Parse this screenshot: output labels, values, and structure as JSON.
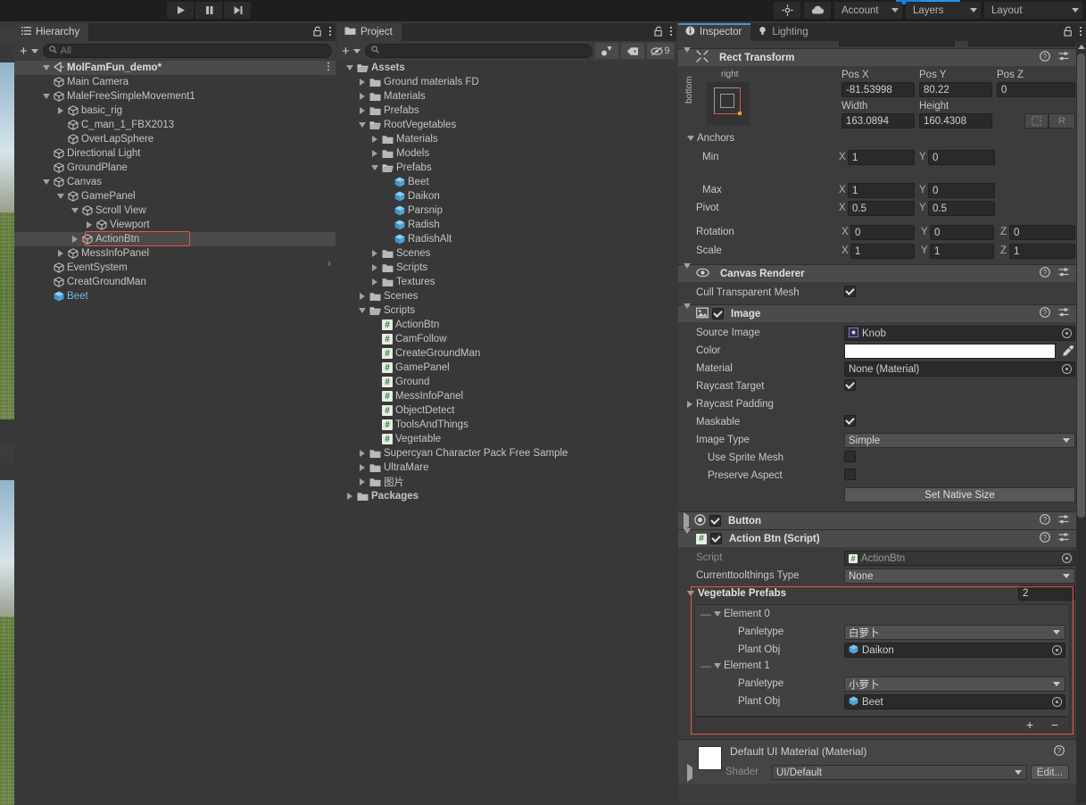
{
  "toolbar": {
    "play_icon": "play-icon",
    "pause_icon": "pause-icon",
    "step_icon": "step-icon",
    "settings_icon": "scene-lighting-icon",
    "cloud_icon": "cloud-icon",
    "account_label": "Account",
    "layers_label": "Layers",
    "layout_label": "Layout",
    "accent_blue": "#2196f3"
  },
  "hierarchy": {
    "tab_label": "Hierarchy",
    "tab_icon": "hierarchy-icon",
    "lock_icon": "lock-icon",
    "menu_icon": "kebab-menu-icon",
    "add_label": "+",
    "search_placeholder": "All",
    "search_value": "",
    "search_icon": "search-icon",
    "scene_name": "MolFamFun_demo*",
    "selected": "ActionBtn",
    "selection_outline_color": "#e8534a",
    "items": [
      {
        "label": "Main Camera",
        "depth": 2,
        "arrow": "none",
        "icon": "gameobject-icon",
        "style": "normal"
      },
      {
        "label": "MaleFreeSimpleMovement1",
        "depth": 2,
        "arrow": "down",
        "icon": "gameobject-icon",
        "style": "normal"
      },
      {
        "label": "basic_rig",
        "depth": 3,
        "arrow": "right",
        "icon": "gameobject-icon",
        "style": "normal"
      },
      {
        "label": "C_man_1_FBX2013",
        "depth": 3,
        "arrow": "none",
        "icon": "gameobject-icon",
        "style": "normal"
      },
      {
        "label": "OverLapSphere",
        "depth": 3,
        "arrow": "none",
        "icon": "gameobject-icon",
        "style": "normal"
      },
      {
        "label": "Directional Light",
        "depth": 2,
        "arrow": "none",
        "icon": "gameobject-icon",
        "style": "normal"
      },
      {
        "label": "GroundPlane",
        "depth": 2,
        "arrow": "none",
        "icon": "gameobject-icon",
        "style": "normal"
      },
      {
        "label": "Canvas",
        "depth": 2,
        "arrow": "down",
        "icon": "gameobject-icon",
        "style": "normal"
      },
      {
        "label": "GamePanel",
        "depth": 3,
        "arrow": "down",
        "icon": "gameobject-icon",
        "style": "normal"
      },
      {
        "label": "Scroll View",
        "depth": 4,
        "arrow": "down",
        "icon": "gameobject-icon",
        "style": "normal"
      },
      {
        "label": "Viewport",
        "depth": 5,
        "arrow": "right",
        "icon": "gameobject-icon",
        "style": "normal"
      },
      {
        "label": "ActionBtn",
        "depth": 4,
        "arrow": "right",
        "icon": "gameobject-icon",
        "style": "selected"
      },
      {
        "label": "MessInfoPanel",
        "depth": 3,
        "arrow": "right",
        "icon": "gameobject-icon",
        "style": "normal"
      },
      {
        "label": "EventSystem",
        "depth": 2,
        "arrow": "none",
        "icon": "gameobject-icon",
        "style": "normal"
      },
      {
        "label": "CreatGroundMan",
        "depth": 2,
        "arrow": "none",
        "icon": "gameobject-icon",
        "style": "normal"
      },
      {
        "label": "Beet",
        "depth": 2,
        "arrow": "none",
        "icon": "prefab-icon",
        "style": "prefab"
      }
    ]
  },
  "project": {
    "tab_label": "Project",
    "tab_icon": "folder-icon",
    "lock_icon": "lock-icon",
    "menu_icon": "kebab-menu-icon",
    "add_label": "+",
    "search_placeholder": "",
    "search_value": "",
    "search_icon": "search-icon",
    "filter_type_icon": "search-by-type-icon",
    "filter_label_icon": "search-by-label-icon",
    "hidden_icon": "hidden-objects-icon",
    "hidden_count": "9",
    "items": [
      {
        "label": "Assets",
        "depth": 0,
        "arrow": "down",
        "icon": "folder-open-icon",
        "bold": true
      },
      {
        "label": "Ground materials FD",
        "depth": 1,
        "arrow": "right",
        "icon": "folder-icon",
        "bold": false
      },
      {
        "label": "Materials",
        "depth": 1,
        "arrow": "right",
        "icon": "folder-icon",
        "bold": false
      },
      {
        "label": "Prefabs",
        "depth": 1,
        "arrow": "right",
        "icon": "folder-icon",
        "bold": false
      },
      {
        "label": "RootVegetables",
        "depth": 1,
        "arrow": "down",
        "icon": "folder-open-icon",
        "bold": false
      },
      {
        "label": "Materials",
        "depth": 2,
        "arrow": "right",
        "icon": "folder-icon",
        "bold": false
      },
      {
        "label": "Models",
        "depth": 2,
        "arrow": "right",
        "icon": "folder-icon",
        "bold": false
      },
      {
        "label": "Prefabs",
        "depth": 2,
        "arrow": "down",
        "icon": "folder-open-icon",
        "bold": false
      },
      {
        "label": "Beet",
        "depth": 3,
        "arrow": "none",
        "icon": "prefab-icon",
        "bold": false
      },
      {
        "label": "Daikon",
        "depth": 3,
        "arrow": "none",
        "icon": "prefab-icon",
        "bold": false
      },
      {
        "label": "Parsnip",
        "depth": 3,
        "arrow": "none",
        "icon": "prefab-icon",
        "bold": false
      },
      {
        "label": "Radish",
        "depth": 3,
        "arrow": "none",
        "icon": "prefab-icon",
        "bold": false
      },
      {
        "label": "RadishAlt",
        "depth": 3,
        "arrow": "none",
        "icon": "prefab-icon",
        "bold": false
      },
      {
        "label": "Scenes",
        "depth": 2,
        "arrow": "right",
        "icon": "folder-icon",
        "bold": false
      },
      {
        "label": "Scripts",
        "depth": 2,
        "arrow": "right",
        "icon": "folder-icon",
        "bold": false
      },
      {
        "label": "Textures",
        "depth": 2,
        "arrow": "right",
        "icon": "folder-icon",
        "bold": false
      },
      {
        "label": "Scenes",
        "depth": 1,
        "arrow": "right",
        "icon": "folder-icon",
        "bold": false
      },
      {
        "label": "Scripts",
        "depth": 1,
        "arrow": "down",
        "icon": "folder-open-icon",
        "bold": false
      },
      {
        "label": "ActionBtn",
        "depth": 2,
        "arrow": "none",
        "icon": "csharp-script-icon",
        "bold": false
      },
      {
        "label": "CamFollow",
        "depth": 2,
        "arrow": "none",
        "icon": "csharp-script-icon",
        "bold": false
      },
      {
        "label": "CreateGroundMan",
        "depth": 2,
        "arrow": "none",
        "icon": "csharp-script-icon",
        "bold": false
      },
      {
        "label": "GamePanel",
        "depth": 2,
        "arrow": "none",
        "icon": "csharp-script-icon",
        "bold": false
      },
      {
        "label": "Ground",
        "depth": 2,
        "arrow": "none",
        "icon": "csharp-script-icon",
        "bold": false
      },
      {
        "label": "MessInfoPanel",
        "depth": 2,
        "arrow": "none",
        "icon": "csharp-script-icon",
        "bold": false
      },
      {
        "label": "ObjectDetect",
        "depth": 2,
        "arrow": "none",
        "icon": "csharp-script-icon",
        "bold": false
      },
      {
        "label": "ToolsAndThings",
        "depth": 2,
        "arrow": "none",
        "icon": "csharp-script-icon",
        "bold": false
      },
      {
        "label": "Vegetable",
        "depth": 2,
        "arrow": "none",
        "icon": "csharp-script-icon",
        "bold": false
      },
      {
        "label": "Supercyan Character Pack Free Sample",
        "depth": 1,
        "arrow": "right",
        "icon": "folder-icon",
        "bold": false
      },
      {
        "label": "UltraMare",
        "depth": 1,
        "arrow": "right",
        "icon": "folder-icon",
        "bold": false
      },
      {
        "label": "图片",
        "depth": 1,
        "arrow": "right",
        "icon": "folder-icon",
        "bold": false
      },
      {
        "label": "Packages",
        "depth": 0,
        "arrow": "right",
        "icon": "folder-icon",
        "bold": true
      }
    ]
  },
  "inspector": {
    "tab_label": "Inspector",
    "tab_icon": "info-icon",
    "lighting_tab_label": "Lighting",
    "lighting_tab_icon": "light-bulb-icon",
    "lock_icon": "lock-icon",
    "menu_icon": "kebab-menu-icon",
    "rect_transform": {
      "title": "Rect Transform",
      "icon": "rect-transform-icon",
      "help_icon": "help-icon",
      "preset_icon": "preset-icon",
      "menu_icon": "kebab-menu-icon",
      "anchor_label_top": "right",
      "anchor_label_left": "bottom",
      "pos_x_label": "Pos X",
      "pos_x": "-81.53998",
      "pos_y_label": "Pos Y",
      "pos_y": "80.22",
      "pos_z_label": "Pos Z",
      "pos_z": "0",
      "width_label": "Width",
      "width": "163.0894",
      "height_label": "Height",
      "height": "160.4308",
      "blueprint_label": "",
      "raw_label": "R",
      "anchors_label": "Anchors",
      "min_label": "Min",
      "min_x": "1",
      "min_y": "0",
      "max_label": "Max",
      "max_x": "1",
      "max_y": "0",
      "pivot_label": "Pivot",
      "pivot_x": "0.5",
      "pivot_y": "0.5",
      "rotation_label": "Rotation",
      "rot_x": "0",
      "rot_y": "0",
      "rot_z": "0",
      "scale_label": "Scale",
      "scale_x": "1",
      "scale_y": "1",
      "scale_z": "1",
      "axis_x": "X",
      "axis_y": "Y",
      "axis_z": "Z"
    },
    "canvas_renderer": {
      "title": "Canvas Renderer",
      "icon": "eye-icon",
      "cull_label": "Cull Transparent Mesh",
      "cull_checked": true
    },
    "image": {
      "title": "Image",
      "icon": "image-component-icon",
      "enabled": true,
      "source_image_label": "Source Image",
      "source_image_value": "Knob",
      "source_image_icon": "sprite-icon",
      "color_label": "Color",
      "color_value": "#ffffff",
      "eyedropper_icon": "eyedropper-icon",
      "material_label": "Material",
      "material_value": "None (Material)",
      "raycast_target_label": "Raycast Target",
      "raycast_target_checked": true,
      "raycast_padding_label": "Raycast Padding",
      "maskable_label": "Maskable",
      "maskable_checked": true,
      "image_type_label": "Image Type",
      "image_type_value": "Simple",
      "use_sprite_mesh_label": "Use Sprite Mesh",
      "use_sprite_mesh_checked": false,
      "preserve_aspect_label": "Preserve Aspect",
      "preserve_aspect_checked": false,
      "set_native_size_label": "Set Native Size"
    },
    "button": {
      "title": "Button",
      "icon": "button-component-icon",
      "enabled": true,
      "collapsed": true
    },
    "action_btn_script": {
      "title": "Action Btn (Script)",
      "icon": "csharp-script-icon",
      "enabled": true,
      "script_label": "Script",
      "script_value": "ActionBtn",
      "currenttool_label": "Currenttoolthings Type",
      "currenttool_value": "None",
      "array_label": "Vegetable Prefabs",
      "array_size": "2",
      "highlight_color": "#e8534a",
      "elements": [
        {
          "name": "Element 0",
          "panletype_label": "Panletype",
          "panletype_value": "白萝卜",
          "plantobj_label": "Plant Obj",
          "plantobj_value": "Daikon"
        },
        {
          "name": "Element 1",
          "panletype_label": "Panletype",
          "panletype_value": "小萝卜",
          "plantobj_label": "Plant Obj",
          "plantobj_value": "Beet"
        }
      ],
      "add_label": "+",
      "remove_label": "−"
    },
    "material_preview": {
      "title": "Default UI Material (Material)",
      "shader_label": "Shader",
      "shader_value": "UI/Default",
      "edit_label": "Edit...",
      "help_icon": "help-icon",
      "menu_icon": "kebab-menu-icon"
    }
  }
}
